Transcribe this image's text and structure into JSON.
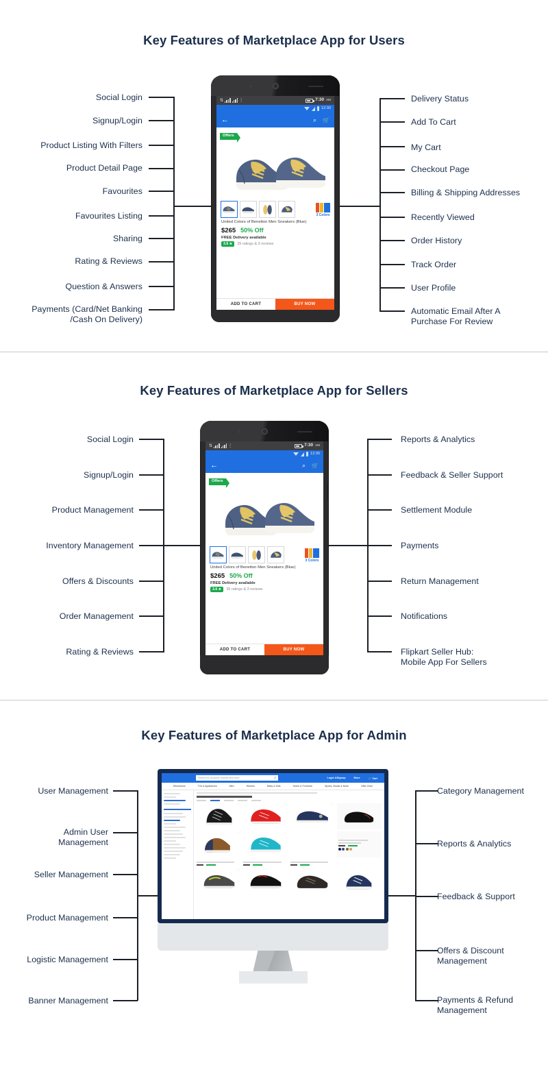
{
  "sections": [
    {
      "id": "users",
      "title": "Key Features of Marketplace App for Users",
      "left_labels": [
        "Social Login",
        "Signup/Login",
        "Product Listing With Filters",
        "Product Detail Page",
        "Favourites",
        "Favourites Listing",
        "Sharing",
        "Rating & Reviews",
        "Question & Answers",
        "Payments (Card/Net Banking\n/Cash On Delivery)"
      ],
      "right_labels": [
        "Delivery Status",
        "Add To Cart",
        "My Cart",
        "Checkout Page",
        "Billing & Shipping Addresses",
        "Recently Viewed",
        "Order History",
        "Track Order",
        "User Profile",
        "Automatic Email After A\nPurchase For Review"
      ]
    },
    {
      "id": "sellers",
      "title": "Key Features of Marketplace App for Sellers",
      "left_labels": [
        "Social Login",
        "Signup/Login",
        "Product Management",
        "Inventory Management",
        "Offers & Discounts",
        "Order Management",
        "Rating & Reviews"
      ],
      "right_labels": [
        "Reports & Analytics",
        "Feedback & Seller Support",
        "Settlement Module",
        "Payments",
        "Return Management",
        "Notifications",
        "Flipkart Seller Hub:\nMobile App For Sellers"
      ]
    },
    {
      "id": "admin",
      "title": "Key Features of Marketplace App for Admin",
      "left_labels": [
        "User Management",
        "Admin User\nManagement",
        "Seller Management",
        "Product Management",
        "Logistic Management",
        "Banner Management"
      ],
      "right_labels": [
        "Category Management",
        "Reports & Analytics",
        "Feedback & Support",
        "Offers & Discount\nManagement",
        "Payments & Refund\nManagement"
      ]
    }
  ],
  "phone": {
    "status_bar": {
      "time": "7:30",
      "meridiem": "AM"
    },
    "app_status": {
      "time": "12:30"
    },
    "appbar": {
      "back_icon": "arrow-left-icon",
      "search_icon": "search-icon",
      "cart_icon": "cart-icon"
    },
    "offers_tag": "Offers",
    "colors_badge": "3 Colors",
    "product": {
      "name": "United Colors of Benetton Men Sneakers (Blue)",
      "price": "$265",
      "discount": "50% Off",
      "delivery": "FREE Delivery available",
      "rating": "3.6 ★",
      "rating_text": "39 ratings & 3 reviews"
    },
    "cta": {
      "add_to_cart": "ADD TO CART",
      "buy_now": "BUY NOW"
    }
  },
  "monitor": {
    "search_placeholder": "Search for products, brands and more",
    "search_icon": "search-icon",
    "account_links": [
      "Login &Signup",
      "More",
      "Cart"
    ],
    "cart_icon": "cart-icon",
    "nav_items": [
      "Electronics",
      "TVs & Appliances",
      "Men",
      "Women",
      "Baby & Kids",
      "Home & Furniture",
      "Sports, Books & More",
      "Offer Zone"
    ]
  },
  "colors": {
    "title": "#1b2e4b",
    "label": "#1b2e4b",
    "line": "#1b1f26",
    "divider": "#c9c9c9",
    "brand_blue": "#1f6fe0",
    "monitor_bezel": "#152a4e",
    "green": "#1ba94c",
    "orange": "#f4571a"
  }
}
